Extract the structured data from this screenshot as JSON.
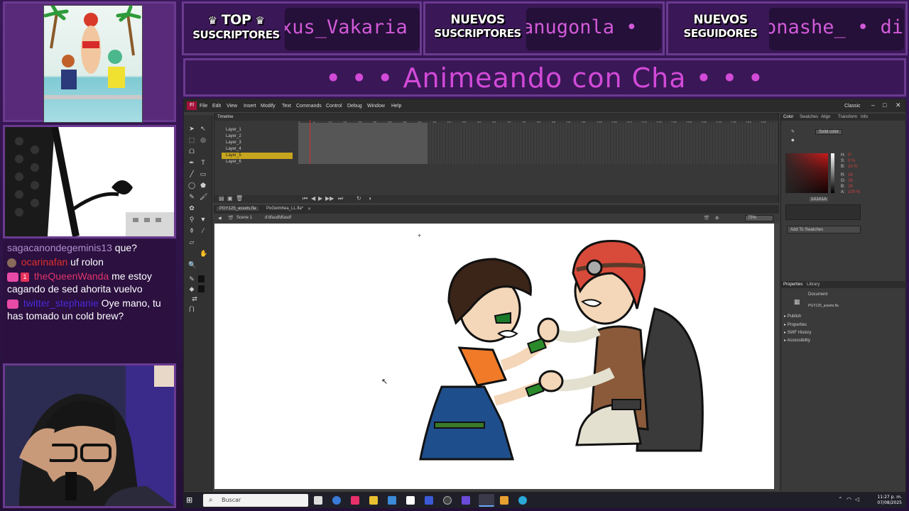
{
  "banners": [
    {
      "title_line1": "TOP",
      "title_line2": "SUSCRIPTORES",
      "ticker": "xus_Vakaria"
    },
    {
      "title_line1": "NUEVOS",
      "title_line2": "SUSCRIPTORES",
      "ticker": "anugonla  •"
    },
    {
      "title_line1": "NUEVOS",
      "title_line2": "SEGUIDORES",
      "ticker": "onashe_  •  di"
    }
  ],
  "stream_title": "• • •  Animeando con Cha  • • •",
  "chat": [
    {
      "user": "sagacanondegeminis13",
      "text": "que?"
    },
    {
      "user": "ocarinafan",
      "text": "uf rolon"
    },
    {
      "sub_badge": "1",
      "user": "theQueenWanda",
      "text": "me estoy cagando de sed ahorita vuelvo"
    },
    {
      "user": "twitter_stephanie",
      "text": "Oye mano, tu has tomado un cold brew?"
    }
  ],
  "flash": {
    "menu": [
      "File",
      "Edit",
      "View",
      "Insert",
      "Modify",
      "Text",
      "Commands",
      "Control",
      "Debug",
      "Window",
      "Help"
    ],
    "workspace": "Classic",
    "timeline_label": "Timeline",
    "layers": [
      "Layer_1",
      "Layer_2",
      "Layer_3",
      "Layer_4",
      "Layer_5",
      "Layer_6"
    ],
    "selected_layer_index": 4,
    "ruler_ticks": [
      "1",
      "5",
      "10",
      "15",
      "20",
      "25",
      "30",
      "35",
      "40",
      "45",
      "50",
      "55",
      "60",
      "65",
      "70",
      "75",
      "80",
      "85",
      "90",
      "95",
      "100",
      "105",
      "110",
      "115",
      "120",
      "125",
      "130",
      "135",
      "140",
      "145",
      "150",
      "155"
    ],
    "doc_tabs": [
      "PGY125_assets.fla",
      "PoGeimhea_LL.fla*"
    ],
    "scene": "Scene 1",
    "symbol": "d'dfasdfdfasdf",
    "zoom": "75%",
    "right_tabs_top": [
      "Color",
      "Swatches",
      "Align",
      "Transform",
      "Info"
    ],
    "color_type": "Solid color",
    "hsb": {
      "H": "0°",
      "S": "0 %",
      "B": "10 %"
    },
    "rgb": {
      "R": "26",
      "G": "26",
      "B": "26",
      "A": "100 %"
    },
    "hex": "1A1A1A",
    "swatch_button": "Add To Swatches",
    "right_tabs_bottom": [
      "Properties",
      "Library"
    ],
    "doc_label": "Document",
    "doc_name": "PGY125_assets.fla",
    "sections": [
      "Publish",
      "Properties",
      "SWF History",
      "Accessibility"
    ]
  },
  "taskbar": {
    "search_placeholder": "Buscar",
    "time": "11:27 p. m.",
    "date": "07/08/2025"
  },
  "colors": {
    "accent_purple": "#d24ad8",
    "frame_purple": "#6a3a8f",
    "selected_layer": "#c8a51e"
  }
}
